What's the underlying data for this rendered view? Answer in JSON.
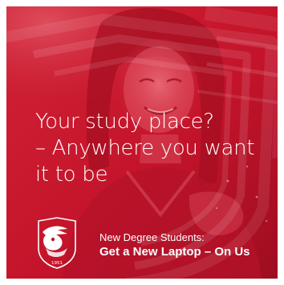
{
  "ad": {
    "headline_lines": [
      "Your study place?",
      "– Anywhere you want",
      "it to be"
    ],
    "promo_subtitle": "New Degree Students:",
    "promo_title": "Get a New Laptop – On Us",
    "logo_year": "1951"
  },
  "colors": {
    "brand_red": "#c4142b",
    "text": "#ffffff",
    "page_background": "#ffffff"
  },
  "icons": {
    "logo": "eagle-shield-icon"
  }
}
